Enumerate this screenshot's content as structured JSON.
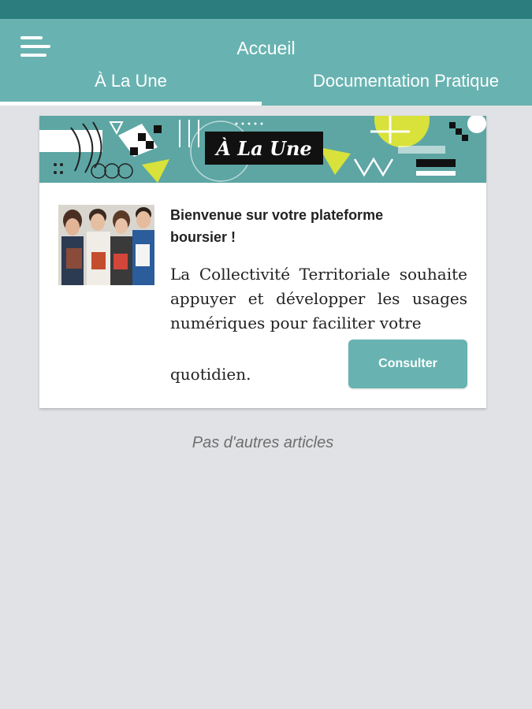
{
  "header": {
    "title": "Accueil",
    "menu_icon": "hamburger-menu-icon",
    "tabs": [
      {
        "label": "À La Une",
        "active": true
      },
      {
        "label": "Documentation Pratique",
        "active": false
      }
    ]
  },
  "colors": {
    "status_bar": "#2b7e7d",
    "header": "#68b3b1",
    "background": "#e1e2e5",
    "accent_yellow": "#d8e23a"
  },
  "banner": {
    "label": "À La Une"
  },
  "article": {
    "title": "Bienvenue sur votre plateforme boursier !",
    "body": "La Collectivité Territoriale souhaite appuyer et développer les usages numériques pour faciliter votre",
    "body_end": "quotidien.",
    "button_label": "Consulter"
  },
  "footer_text": "Pas d'autres articles"
}
